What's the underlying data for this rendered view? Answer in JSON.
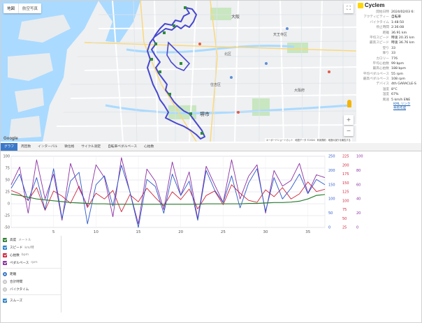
{
  "map": {
    "type_tabs": [
      "地図",
      "航空写真"
    ],
    "fullscreen_icon": "fullscreen-icon",
    "zoom_in": "+",
    "zoom_out": "−",
    "pegman_icon": "pegman-icon",
    "google": "Google",
    "attribution": "キーボードショートカット　地図データ ©2024　利用規約　地図の誤りを報告する",
    "labels": [
      "堺市",
      "大阪",
      "北区",
      "天王寺区",
      "大阪府",
      "住吉区"
    ]
  },
  "info": {
    "brand": "Cyclem",
    "stats": [
      {
        "key": "開始日時",
        "value": "2024/02/03 6:"
      },
      {
        "key": "アクティビティー",
        "value": "自転車"
      },
      {
        "key": "バイクタイム",
        "value": "1:48:50"
      },
      {
        "key": "停止時間",
        "value": "2:36:08"
      },
      {
        "key": "距離",
        "value": "36.91 km"
      },
      {
        "key": "平均スピード",
        "value": "時速 20.35 km"
      },
      {
        "key": "最高スピード",
        "value": "時速 36.76 km"
      },
      {
        "key": "登り",
        "value": "33"
      },
      {
        "key": "降り",
        "value": "33"
      },
      {
        "key": "カロリー",
        "value": "776"
      },
      {
        "key": "平均心拍数",
        "value": "99 bpm"
      },
      {
        "key": "最高心拍数",
        "value": "188 bpm"
      },
      {
        "key": "平均ペダルペース",
        "value": "55 rpm"
      },
      {
        "key": "最高ペダルペース",
        "value": "108 rpm"
      },
      {
        "key": "デバイス",
        "value": "4th GARACLE-S"
      },
      {
        "key": "温度",
        "value": "8°C"
      },
      {
        "key": "湿度",
        "value": "67%"
      },
      {
        "key": "風速",
        "value": "5 km/h ENE"
      }
    ],
    "link1": "KML リンク",
    "link2": "共有作成"
  },
  "tabs": [
    "グラフ",
    "周回数",
    "インターバル",
    "微位格",
    "サイクル測定",
    "自転車ペダルペース",
    "心拍数"
  ],
  "chart_data": {
    "type": "line",
    "x_ticks": [
      5,
      10,
      15,
      20,
      25,
      30,
      35
    ],
    "xlim": [
      0,
      37
    ],
    "left_axis": {
      "ticks": [
        "100",
        "75",
        "50",
        "25",
        "0",
        "-25",
        "-50"
      ],
      "ylim": [
        -50,
        110
      ]
    },
    "right_axis_1": {
      "ticks": [
        "250",
        "200",
        "150",
        "100",
        "50",
        "0"
      ],
      "ylim": [
        0,
        250
      ]
    },
    "right_axis_2": {
      "ticks": [
        "225",
        "200",
        "175",
        "150",
        "125",
        "100",
        "75",
        "50",
        "25"
      ],
      "ylim": [
        25,
        225
      ]
    },
    "right_axis_3": {
      "ticks": [
        "100",
        "80",
        "60",
        "40",
        "20",
        "0"
      ],
      "ylim": [
        0,
        100
      ]
    },
    "colors": {
      "elevation": "#2e7d32",
      "speed": "#2b57c8",
      "heart": "#d0243a",
      "cadence": "#8b2fa3"
    },
    "series": [
      {
        "name": "高度",
        "values": [
          25,
          22,
          18,
          14,
          12,
          10,
          8,
          6,
          5,
          4,
          3,
          3,
          2,
          2,
          2,
          2,
          2,
          2,
          2,
          2,
          2,
          2,
          2,
          3,
          3,
          3,
          3,
          3,
          4,
          4,
          5,
          6,
          6,
          7,
          9,
          14,
          22,
          24
        ]
      },
      {
        "name": "スピード",
        "values": [
          22,
          30,
          15,
          28,
          10,
          33,
          5,
          26,
          31,
          2,
          24,
          29,
          12,
          35,
          20,
          0,
          27,
          23,
          8,
          30,
          18,
          26,
          4,
          32,
          21,
          14,
          29,
          11,
          25,
          33,
          9,
          28,
          16,
          22,
          30,
          19,
          27,
          24
        ]
      },
      {
        "name": "心拍数",
        "values": [
          130,
          118,
          95,
          140,
          60,
          128,
          110,
          85,
          145,
          70,
          120,
          100,
          130,
          55,
          115,
          90,
          138,
          105,
          75,
          125,
          98,
          135,
          65,
          112,
          128,
          80,
          150,
          120,
          95,
          88,
          132,
          108,
          140,
          100,
          118,
          160,
          126,
          134
        ]
      },
      {
        "name": "ペダルペース",
        "values": [
          60,
          85,
          20,
          95,
          40,
          75,
          10,
          90,
          55,
          30,
          88,
          70,
          15,
          98,
          50,
          5,
          82,
          65,
          25,
          92,
          45,
          78,
          12,
          86,
          60,
          35,
          95,
          40,
          72,
          88,
          20,
          80,
          58,
          66,
          90,
          48,
          74,
          70
        ]
      }
    ]
  },
  "legend": {
    "items": [
      {
        "label": "高度",
        "unit": "メートル",
        "color": "#2e7d32"
      },
      {
        "label": "スピード",
        "unit": "km/時",
        "color": "#2b7fc7"
      },
      {
        "label": "心拍数",
        "unit": "bpm",
        "color": "#d0243a"
      },
      {
        "label": "ペダルペース",
        "unit": "rpm",
        "color": "#8b2fa3"
      }
    ],
    "x_modes": [
      "距離",
      "合計時間",
      "バイクタイム"
    ],
    "smooth": "スムーズ"
  }
}
